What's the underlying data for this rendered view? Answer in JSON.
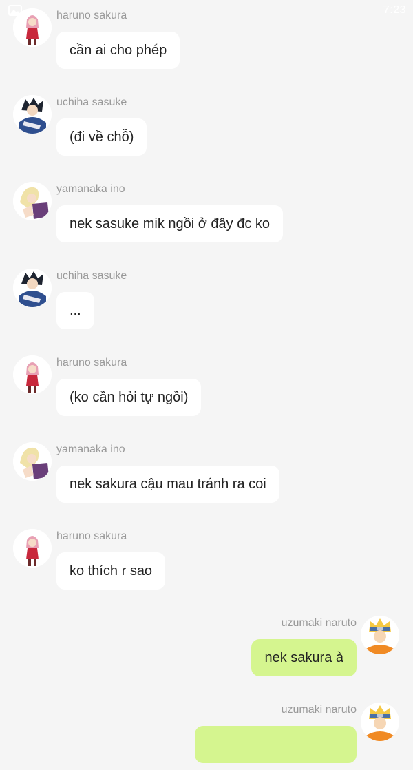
{
  "status": {
    "time": "7:23"
  },
  "messages": [
    {
      "side": "left",
      "sender": "haruno sakura",
      "avatar": "sakura",
      "text": "cần ai cho phép"
    },
    {
      "side": "left",
      "sender": "uchiha sasuke",
      "avatar": "sasuke",
      "text": "(đi về chỗ)"
    },
    {
      "side": "left",
      "sender": "yamanaka ino",
      "avatar": "ino",
      "text": "nek sasuke mik ngồi ở đây đc ko"
    },
    {
      "side": "left",
      "sender": "uchiha sasuke",
      "avatar": "sasuke",
      "text": "..."
    },
    {
      "side": "left",
      "sender": "haruno sakura",
      "avatar": "sakura",
      "text": "(ko cần hỏi tự ngồi)"
    },
    {
      "side": "left",
      "sender": "yamanaka ino",
      "avatar": "ino",
      "text": "nek sakura cậu mau tránh ra coi"
    },
    {
      "side": "left",
      "sender": "haruno sakura",
      "avatar": "sakura",
      "text": "ko thích r sao"
    },
    {
      "side": "right",
      "sender": "uzumaki naruto",
      "avatar": "naruto",
      "text": "nek sakura à"
    },
    {
      "side": "right",
      "sender": "uzumaki naruto",
      "avatar": "naruto",
      "text": ""
    }
  ],
  "colors": {
    "background": "#f5f5f5",
    "bubble_incoming": "#ffffff",
    "bubble_outgoing": "#d5f58f",
    "sender_name": "#999999",
    "message_text": "#222222"
  }
}
